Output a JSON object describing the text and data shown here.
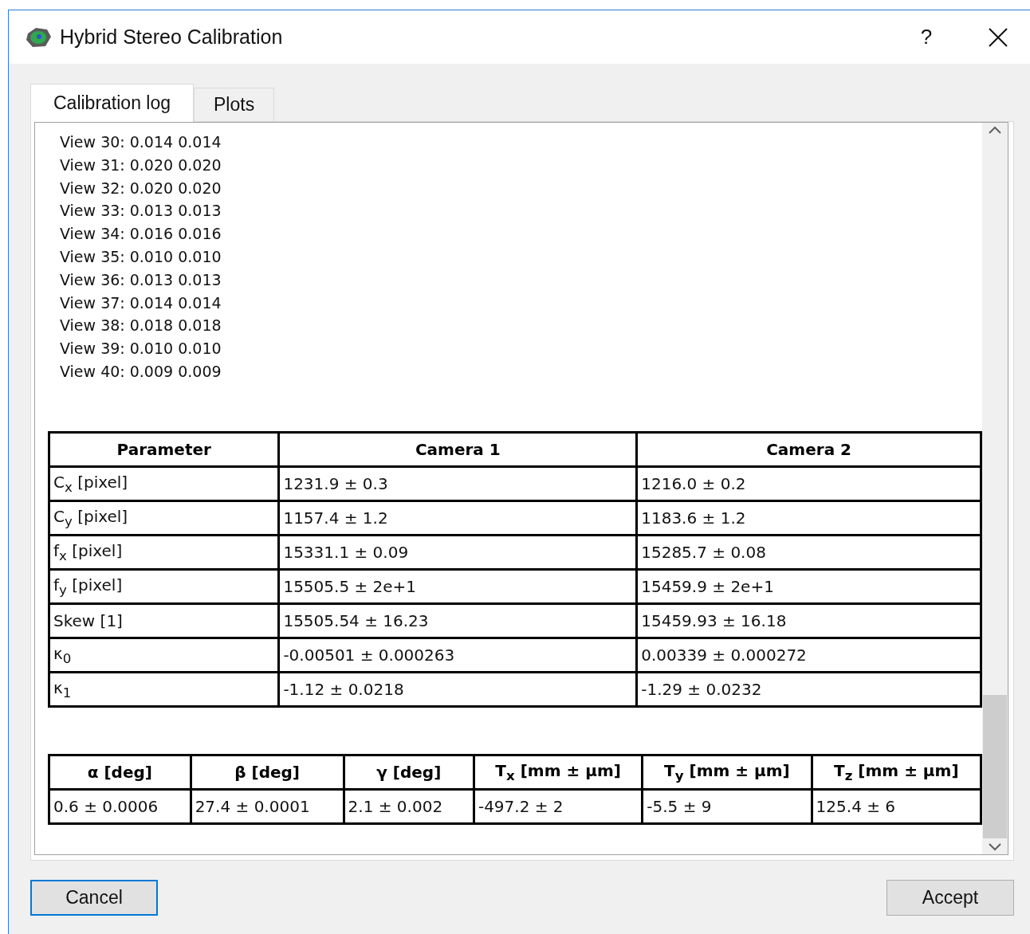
{
  "window": {
    "title": "Hybrid Stereo Calibration"
  },
  "title_buttons": {
    "help": "?"
  },
  "tabs": [
    {
      "label": "Calibration log",
      "selected": true
    },
    {
      "label": "Plots",
      "selected": false
    }
  ],
  "log_lines": [
    "View 30: 0.014 0.014",
    "View 31: 0.020 0.020",
    "View 32: 0.020 0.020",
    "View 33: 0.013 0.013",
    "View 34: 0.016 0.016",
    "View 35: 0.010 0.010",
    "View 36: 0.013 0.013",
    "View 37: 0.014 0.014",
    "View 38: 0.018 0.018",
    "View 39: 0.010 0.010",
    "View 40: 0.009 0.009"
  ],
  "intrinsics_table": {
    "columns": [
      "Parameter",
      "Camera 1",
      "Camera 2"
    ],
    "rows": [
      [
        "C$_{x}$ [pixel]",
        "1231.9 ± 0.3",
        "1216.0 ± 0.2"
      ],
      [
        "C$_{y}$ [pixel]",
        "1157.4 ± 1.2",
        "1183.6 ± 1.2"
      ],
      [
        "f$_{x}$ [pixel]",
        "15331.1 ± 0.09",
        "15285.7 ± 0.08"
      ],
      [
        "f$_{y}$ [pixel]",
        "15505.5 ± 2e+1",
        "15459.9 ± 2e+1"
      ],
      [
        "Skew [1]",
        "15505.54 ± 16.23",
        "15459.93 ± 16.18"
      ],
      [
        "κ$_{0}$",
        "-0.00501 ± 0.000263",
        "0.00339 ± 0.000272"
      ],
      [
        "κ$_{1}$",
        "-1.12 ± 0.0218",
        "-1.29 ± 0.0232"
      ]
    ]
  },
  "extrinsics_table": {
    "columns": [
      "α [deg]",
      "β [deg]",
      "γ [deg]",
      "T$_{x}$ [mm ± μm]",
      "T$_{y}$ [mm ± μm]",
      "T$_{z}$ [mm ± μm]"
    ],
    "rows": [
      [
        "0.6 ± 0.0006",
        "27.4 ± 0.0001",
        "2.1 ± 0.002",
        "-497.2 ± 2",
        "-5.5 ± 9",
        "125.4 ± 6"
      ]
    ]
  },
  "buttons": [
    {
      "label": "Cancel",
      "kind": "focused"
    },
    {
      "label": "Accept",
      "kind": "normal"
    }
  ]
}
